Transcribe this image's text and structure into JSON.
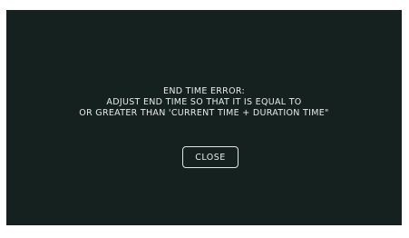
{
  "dialog": {
    "lines": [
      "END TIME ERROR:",
      "ADJUST END TIME SO THAT IT IS EQUAL TO",
      "OR GREATER THAN 'CURRENT TIME + DURATION TIME\""
    ],
    "close_label": "CLOSE"
  },
  "colors": {
    "background": "#15211f",
    "text": "#e6ecea"
  }
}
